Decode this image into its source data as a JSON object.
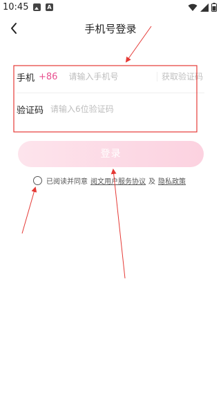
{
  "status_bar": {
    "time": "10:45",
    "left_icons": [
      "gallery-icon",
      "a-icon"
    ],
    "a_icon_letter": "A",
    "right_icons": [
      "wifi-icon",
      "signal-icon",
      "battery-icon"
    ]
  },
  "header": {
    "back_icon": "chevron-left-icon",
    "title": "手机号登录"
  },
  "form": {
    "phone_label": "手机",
    "country_code": "+86",
    "phone_placeholder": "请输入手机号",
    "get_code_label": "获取验证码",
    "code_label": "验证码",
    "code_placeholder": "请输入6位验证码"
  },
  "login_button": {
    "label": "登录"
  },
  "agreement": {
    "prefix": "已阅读并同意",
    "service_link": "阅文用户服务协议",
    "conjunction": "及",
    "privacy_link": "隐私政策"
  },
  "colors": {
    "accent": "#e8508f",
    "button_gradient_start": "#fde4ec",
    "button_gradient_end": "#fcd2e0",
    "annotation": "#e53935"
  }
}
